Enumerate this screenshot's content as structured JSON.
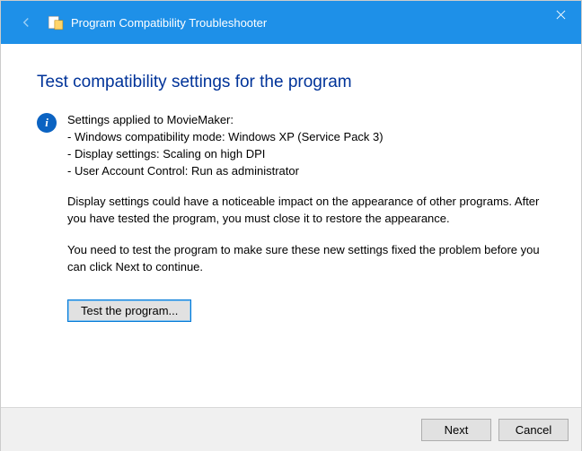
{
  "titlebar": {
    "title": "Program Compatibility Troubleshooter"
  },
  "heading": "Test compatibility settings for the program",
  "settings": {
    "intro": "Settings applied to MovieMaker:",
    "line1": "- Windows compatibility mode: Windows XP (Service Pack 3)",
    "line2": "- Display settings:  Scaling on high DPI",
    "line3": "- User Account Control:  Run as administrator"
  },
  "paragraph1": "Display settings could have a noticeable impact on the appearance of other programs. After you have tested the program, you must close it to restore the appearance.",
  "paragraph2": "You need to test the program to make sure these new settings fixed the problem before you can click Next to continue.",
  "buttons": {
    "test": "Test the program...",
    "next": "Next",
    "cancel": "Cancel"
  }
}
